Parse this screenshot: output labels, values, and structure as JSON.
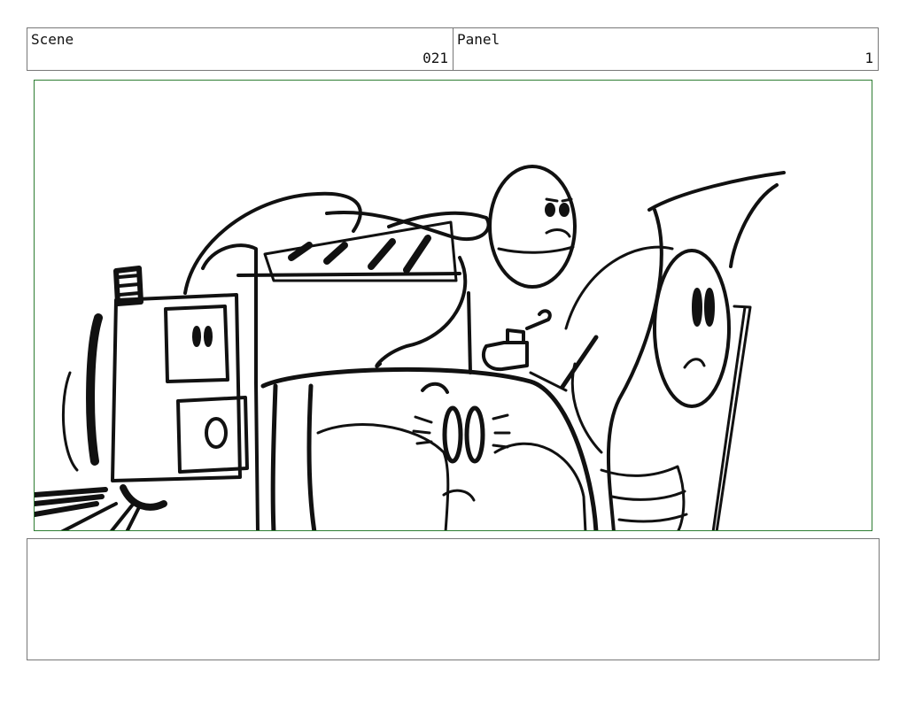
{
  "header": {
    "scene_label": "Scene",
    "scene_value": "021",
    "panel_label": "Panel",
    "panel_value": "1"
  },
  "frame": {
    "border_color": "#2e7d32",
    "sketch_color": "#111111"
  },
  "notes": {
    "text": ""
  }
}
